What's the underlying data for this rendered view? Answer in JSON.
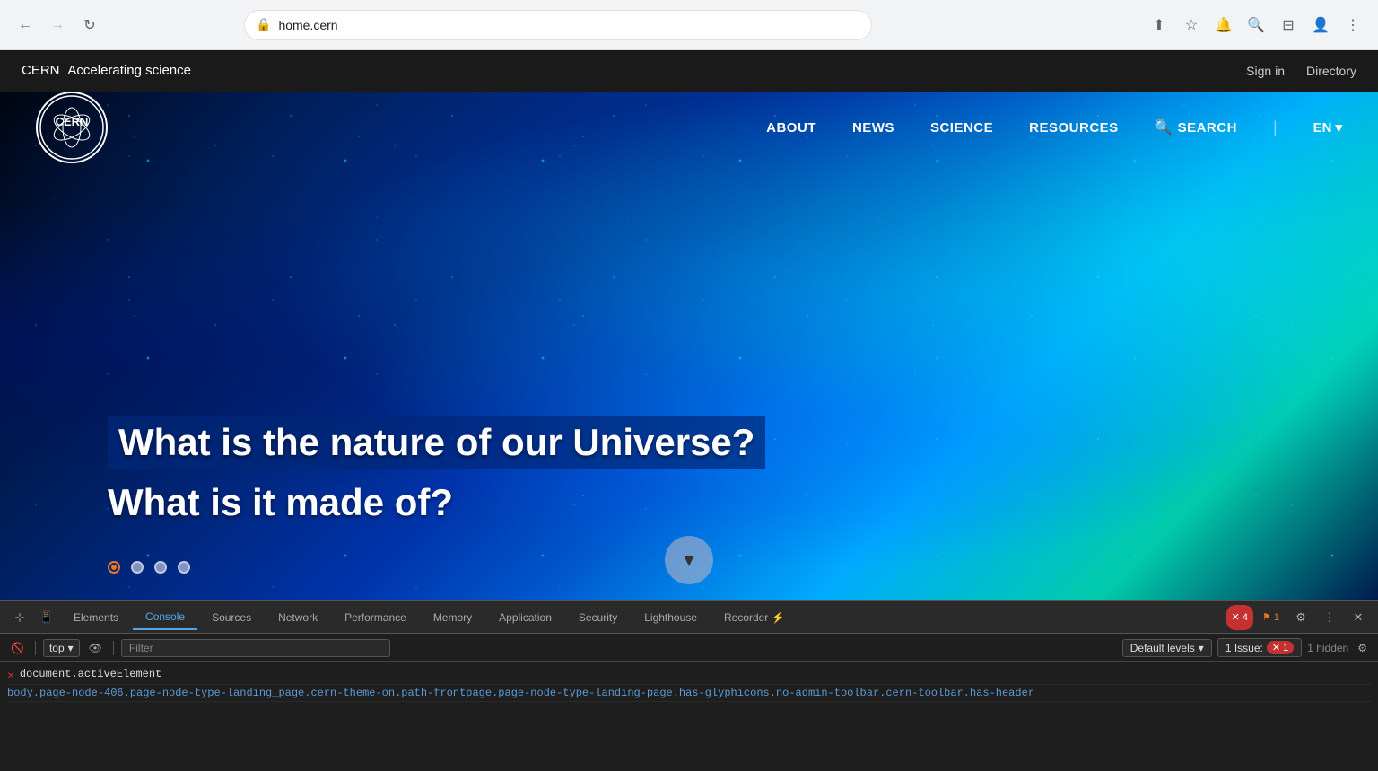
{
  "browser": {
    "url": "home.cern",
    "back_disabled": false,
    "forward_disabled": true
  },
  "topbar": {
    "brand": "CERN",
    "tagline": "Accelerating science",
    "signin_label": "Sign in",
    "directory_label": "Directory"
  },
  "nav": {
    "items": [
      {
        "label": "ABOUT",
        "id": "about"
      },
      {
        "label": "NEWS",
        "id": "news"
      },
      {
        "label": "SCIENCE",
        "id": "science"
      },
      {
        "label": "RESOURCES",
        "id": "resources"
      }
    ],
    "search_label": "SEARCH",
    "lang_label": "EN"
  },
  "hero": {
    "title_line1": "What is the nature of our Universe?",
    "title_line2": "What is it made of?",
    "slider_dots": [
      {
        "active": true
      },
      {
        "active": false
      },
      {
        "active": false
      },
      {
        "active": false
      }
    ]
  },
  "devtools": {
    "tabs": [
      {
        "label": "Elements",
        "active": false
      },
      {
        "label": "Console",
        "active": true
      },
      {
        "label": "Sources",
        "active": false
      },
      {
        "label": "Network",
        "active": false
      },
      {
        "label": "Performance",
        "active": false
      },
      {
        "label": "Memory",
        "active": false
      },
      {
        "label": "Application",
        "active": false
      },
      {
        "label": "Security",
        "active": false
      },
      {
        "label": "Lighthouse",
        "active": false
      },
      {
        "label": "Recorder",
        "active": false
      }
    ],
    "error_count": "4",
    "warning_count": "1",
    "context_selector": "top",
    "filter_placeholder": "Filter",
    "default_levels_label": "Default levels",
    "issues_label": "1 Issue:",
    "issues_count": "1",
    "hidden_label": "1 hidden",
    "console_lines": [
      {
        "type": "error",
        "text": "document.activeElement"
      },
      {
        "type": "text",
        "text": "body.page-node-406.page-node-type-landing_page.cern-theme-on.path-frontpage.page-node-type-landing-page.has-glyphicons.no-admin-toolbar.cern-toolbar.has-header"
      }
    ]
  },
  "icons": {
    "back": "←",
    "forward": "→",
    "refresh": "↻",
    "lock": "🔒",
    "share": "⬆",
    "star": "☆",
    "notification": "🔔",
    "zoom": "🔍",
    "layout": "⊟",
    "profile": "👤",
    "more": "⋮",
    "chevron_down": "▾",
    "search": "🔍",
    "scroll_down": "▾",
    "devtools_inspect": "⊹",
    "devtools_device": "📱",
    "devtools_close": "✕",
    "devtools_more": "⋮",
    "devtools_settings": "⚙",
    "devtools_eye": "👁",
    "devtools_clear": "🚫",
    "error_x": "✕",
    "warning_flag": "⚑"
  }
}
